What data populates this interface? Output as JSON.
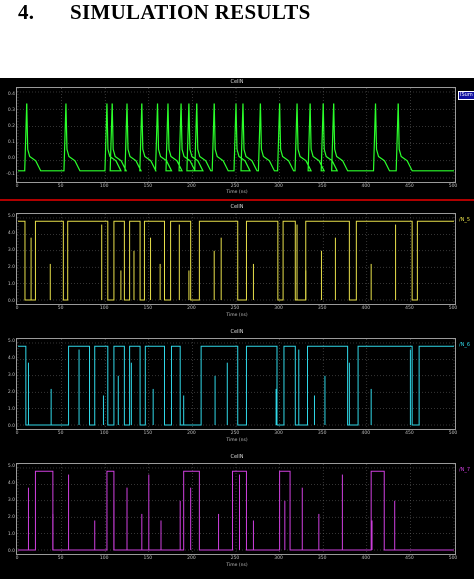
{
  "heading": {
    "number": "4.",
    "text": "SIMULATION RESULTS"
  },
  "colors": {
    "background": "#000000",
    "grid": "#6a6a6a",
    "panel_border": "#9a9a9a",
    "separator": "#b00000"
  },
  "chart_data": [
    {
      "type": "line",
      "title": "CellN",
      "xlabel": "Time (ns)",
      "ylabel": "",
      "xlim": [
        0,
        500
      ],
      "ylim": [
        -0.1,
        0.5
      ],
      "x_ticks": [
        "0",
        "50",
        "100",
        "150",
        "200",
        "250",
        "300",
        "350",
        "400",
        "450",
        "500"
      ],
      "y_ticks": [
        "0.4",
        "0.3",
        "0.2",
        "0.1",
        "0.0",
        "-0.1"
      ],
      "legend": "ISum",
      "legend_selected": true,
      "color": "#2bff2b",
      "spikes_x": [
        10,
        55,
        102,
        108,
        125,
        142,
        160,
        172,
        187,
        196,
        205,
        225,
        250,
        258,
        278,
        300,
        320,
        335,
        350,
        362,
        410,
        436
      ],
      "baseline": -0.05
    },
    {
      "type": "line",
      "title": "CellN",
      "xlabel": "Time (ns)",
      "ylabel": "",
      "xlim": [
        0,
        500
      ],
      "ylim": [
        0,
        5
      ],
      "x_ticks": [
        "0",
        "50",
        "100",
        "150",
        "200",
        "250",
        "300",
        "350",
        "400",
        "450",
        "500"
      ],
      "y_ticks": [
        "5.0",
        "4.0",
        "3.0",
        "2.0",
        "1.0",
        "0.0"
      ],
      "legend": "/N_5",
      "color": "#e8e04a",
      "high_intervals": [
        [
          0,
          8
        ],
        [
          20,
          52
        ],
        [
          57,
          103
        ],
        [
          110,
          122
        ],
        [
          128,
          140
        ],
        [
          145,
          168
        ],
        [
          175,
          198
        ],
        [
          208,
          252
        ],
        [
          262,
          298
        ],
        [
          304,
          318
        ],
        [
          330,
          380
        ],
        [
          388,
          452
        ],
        [
          458,
          500
        ]
      ],
      "glitches_x": [
        15,
        37,
        96,
        118,
        133,
        152,
        163,
        185,
        196,
        225,
        233,
        270,
        320,
        330,
        348,
        364,
        405,
        433
      ]
    },
    {
      "type": "line",
      "title": "CellN",
      "xlabel": "Time (ns)",
      "ylabel": "",
      "xlim": [
        0,
        500
      ],
      "ylim": [
        0,
        5
      ],
      "x_ticks": [
        "0",
        "50",
        "100",
        "150",
        "200",
        "250",
        "300",
        "350",
        "400",
        "450",
        "500"
      ],
      "y_ticks": [
        "5.0",
        "4.0",
        "3.0",
        "2.0",
        "1.0",
        "0.0"
      ],
      "legend": "/N_6",
      "color": "#30d8e8",
      "high_intervals": [
        [
          0,
          9
        ],
        [
          58,
          82
        ],
        [
          88,
          103
        ],
        [
          110,
          122
        ],
        [
          128,
          140
        ],
        [
          146,
          168
        ],
        [
          176,
          186
        ],
        [
          210,
          252
        ],
        [
          262,
          297
        ],
        [
          305,
          318
        ],
        [
          332,
          378
        ],
        [
          390,
          452
        ],
        [
          460,
          500
        ]
      ],
      "glitches_x": [
        12,
        38,
        70,
        98,
        115,
        130,
        155,
        168,
        190,
        226,
        240,
        296,
        322,
        340,
        352,
        380,
        405,
        450
      ]
    },
    {
      "type": "line",
      "title": "CellN",
      "xlabel": "Time (ns)",
      "ylabel": "",
      "xlim": [
        0,
        500
      ],
      "ylim": [
        0,
        5
      ],
      "x_ticks": [
        "0",
        "50",
        "100",
        "150",
        "200",
        "250",
        "300",
        "350",
        "400",
        "450",
        "500"
      ],
      "y_ticks": [
        "5.0",
        "4.0",
        "3.0",
        "2.0",
        "1.0",
        "0.0"
      ],
      "legend": "/N_7",
      "color": "#d040e0",
      "high_intervals": [
        [
          20,
          40
        ],
        [
          102,
          110
        ],
        [
          190,
          208
        ],
        [
          246,
          262
        ],
        [
          300,
          312
        ],
        [
          405,
          420
        ]
      ],
      "glitches_x": [
        12,
        40,
        58,
        88,
        110,
        125,
        142,
        150,
        164,
        186,
        198,
        230,
        254,
        270,
        306,
        326,
        345,
        372,
        406,
        432
      ]
    }
  ]
}
